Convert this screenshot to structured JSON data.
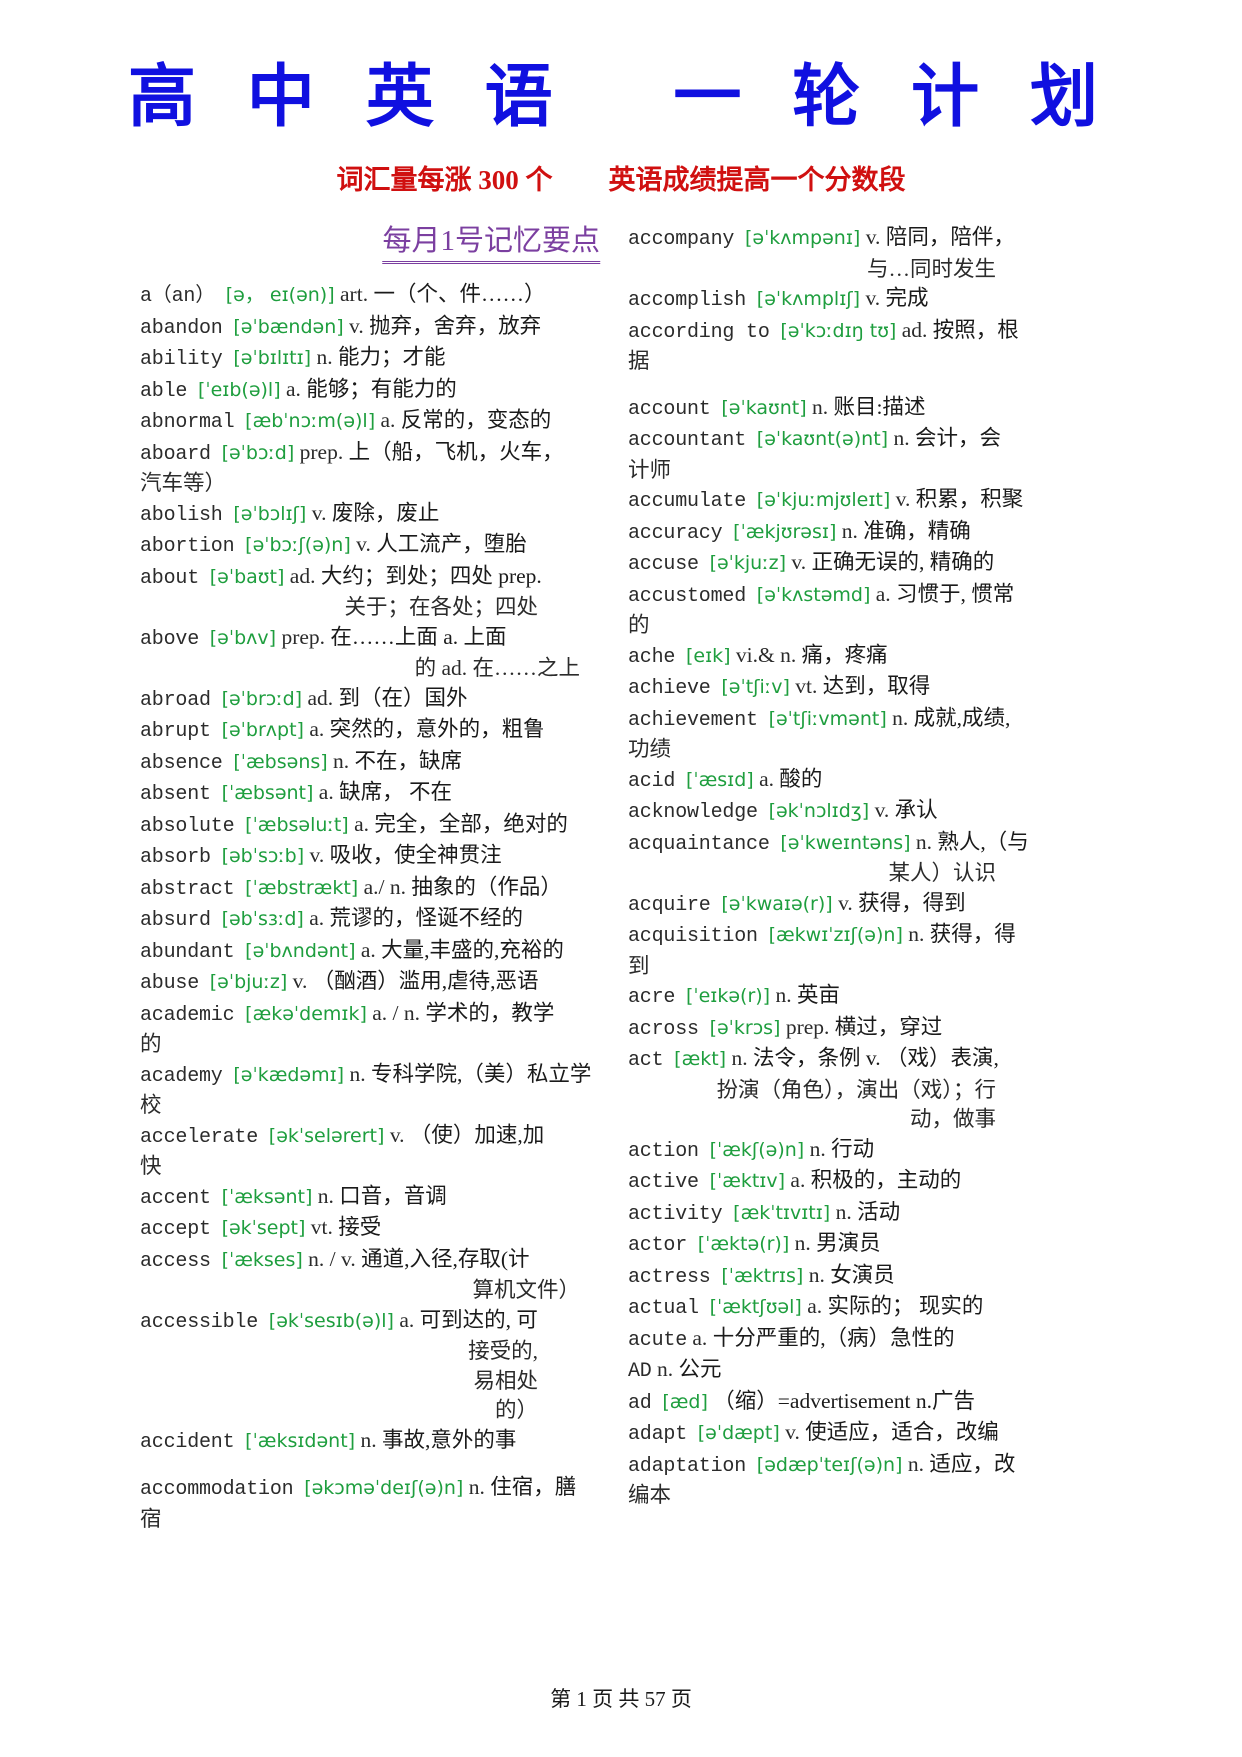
{
  "header": {
    "title": "高 中 英 语   一 轮 计 划",
    "subtitle_left": "词汇量每涨 300 个",
    "subtitle_right": "英语成绩提高一个分数段",
    "title_color": "#1010e0",
    "subtitle_color": "#d01010"
  },
  "section": {
    "heading": "每月1号记忆要点",
    "heading_color": "#7b3fa0"
  },
  "styles": {
    "phonetic_color": "#1e9e3e",
    "text_color": "#2b2b2b"
  },
  "left_column": [
    {
      "word": "a（an）",
      "phonetic": "[ə， eɪ(ən)]",
      "pos": "art.",
      "cn": "一（个、件……）"
    },
    {
      "word": "abandon",
      "phonetic": "[əˈbændən]",
      "pos": "v.",
      "cn": "抛弃，舍弃，放弃"
    },
    {
      "word": "ability",
      "phonetic": "[əˈbɪlɪtɪ]",
      "pos": "n.",
      "cn": "能力；才能"
    },
    {
      "word": "able",
      "phonetic": "[ˈeɪb(ə)l]",
      "pos": "a.",
      "cn": "能够；有能力的"
    },
    {
      "word": "abnormal",
      "phonetic": "[æbˈnɔːm(ə)l]",
      "pos": "a.",
      "cn": "反常的，变态的"
    },
    {
      "word": "aboard",
      "phonetic": "[əˈbɔːd]",
      "pos": "prep.",
      "cn": "上（船，飞机，火车，",
      "cont": [
        "汽车等）"
      ],
      "cont_align": "left"
    },
    {
      "word": "abolish",
      "phonetic": "[əˈbɔlɪʃ]",
      "pos": "v.",
      "cn": "废除，废止"
    },
    {
      "word": "abortion",
      "phonetic": "[əˈbɔːʃ(ə)n]",
      "pos": "v.",
      "cn": "人工流产，堕胎"
    },
    {
      "word": "about",
      "phonetic": "[əˈbaʊt]",
      "pos": "ad.",
      "cn": "大约；到处；四处 prep.",
      "cont": [
        "关于；在各处；四处"
      ],
      "cont_align": "wide"
    },
    {
      "word": "above",
      "phonetic": "[əˈbʌv]",
      "pos": "prep.",
      "cn": "在……上面 a. 上面",
      "cont": [
        "的 ad. 在……之上"
      ],
      "cont_align": "mid"
    },
    {
      "word": "abroad",
      "phonetic": "[əˈbrɔːd]",
      "pos": "ad.",
      "cn": "到（在）国外"
    },
    {
      "word": "abrupt",
      "phonetic": "[əˈbrʌpt]",
      "pos": "a.",
      "cn": "突然的，意外的，粗鲁"
    },
    {
      "word": "absence",
      "phonetic": "[ˈæbsəns]",
      "pos": "n.",
      "cn": "不在，缺席"
    },
    {
      "word": "absent",
      "phonetic": "[ˈæbsənt]",
      "pos": "a.",
      "cn": "缺席， 不在"
    },
    {
      "word": "absolute",
      "phonetic": "[ˈæbsəluːt]",
      "pos": "a.",
      "cn": "完全，全部，绝对的"
    },
    {
      "word": "absorb",
      "phonetic": "[əbˈsɔːb]",
      "pos": "v.",
      "cn": "吸收，使全神贯注"
    },
    {
      "word": "abstract",
      "phonetic": "[ˈæbstrækt]",
      "pos": "a./ n.",
      "cn": "抽象的（作品）"
    },
    {
      "word": "absurd",
      "phonetic": "[əbˈsɜːd]",
      "pos": "a.",
      "cn": "荒谬的，怪诞不经的"
    },
    {
      "word": "abundant",
      "phonetic": "[əˈbʌndənt]",
      "pos": "a.",
      "cn": "大量,丰盛的,充裕的"
    },
    {
      "word": "abuse",
      "phonetic": "[əˈbjuːz]",
      "pos": "v.",
      "cn": "（酗酒）滥用,虐待,恶语"
    },
    {
      "word": "academic",
      "phonetic": "[ækəˈdemɪk]",
      "pos": "a. / n.",
      "cn": "学术的，教学",
      "cont": [
        "的"
      ],
      "cont_align": "left"
    },
    {
      "word": "academy",
      "phonetic": "[əˈkædəmɪ]",
      "pos": "n.",
      "cn": "专科学院,（美）私立学",
      "cont": [
        "校"
      ],
      "cont_align": "left"
    },
    {
      "word": "accelerate",
      "phonetic": "[əkˈselərert]",
      "pos": "v.",
      "cn": "（使）加速,加",
      "cont": [
        "快"
      ],
      "cont_align": "left"
    },
    {
      "word": "accent",
      "phonetic": "[ˈæksənt]",
      "pos": "n.",
      "cn": "口音，音调"
    },
    {
      "word": "accept",
      "phonetic": "[əkˈsept]",
      "pos": "vt.",
      "cn": "接受"
    },
    {
      "word": "access",
      "phonetic": "[ˈækses]",
      "pos": "n. / v.",
      "cn": "通道,入径,存取(计",
      "cont": [
        "算机文件）"
      ],
      "cont_align": "mid"
    },
    {
      "word": "accessible",
      "phonetic": "[əkˈsesɪb(ə)l]",
      "pos": "a.",
      "cn": "可到达的, 可",
      "cont": [
        "接受的,",
        "易相处",
        "的）"
      ],
      "cont_align": "wide"
    },
    {
      "word": "accident",
      "phonetic": "[ˈæksɪdənt]",
      "pos": "n.",
      "cn": "事故,意外的事",
      "gap_after": true
    },
    {
      "word": "accommodation",
      "phonetic": "[əkɔməˈdeɪʃ(ə)n]",
      "pos": "n.",
      "cn": "住宿，膳",
      "cont": [
        "宿"
      ],
      "cont_align": "left"
    }
  ],
  "right_column": [
    {
      "word": "accompany",
      "phonetic": "[əˈkʌmpənɪ]",
      "pos": "v.",
      "cn": "陪同，陪伴，",
      "cont": [
        "与…同时发生"
      ],
      "cont_align": "wide"
    },
    {
      "word": "accomplish",
      "phonetic": "[əˈkʌmplɪʃ]",
      "pos": "v.",
      "cn": "完成"
    },
    {
      "word": "according to",
      "phonetic": "[əˈkɔːdɪŋ tʊ]",
      "pos": "ad.",
      "cn": "按照，根",
      "cont": [
        "据"
      ],
      "cont_align": "left",
      "gap_after": true
    },
    {
      "word": "account",
      "phonetic": "[əˈkaʊnt]",
      "pos": "n.",
      "cn": "账目:描述"
    },
    {
      "word": "accountant",
      "phonetic": "[əˈkaʊnt(ə)nt]",
      "pos": "n.",
      "cn": "会计，会",
      "cont": [
        "计师"
      ],
      "cont_align": "left"
    },
    {
      "word": "accumulate",
      "phonetic": "[əˈkjuːmjʊleɪt]",
      "pos": "v.",
      "cn": "积累，积聚"
    },
    {
      "word": "accuracy",
      "phonetic": "[ˈækjʊrəsɪ]",
      "pos": "n.",
      "cn": "准确，精确"
    },
    {
      "word": "accuse",
      "phonetic": "[əˈkjuːz]",
      "pos": "v.",
      "cn": "正确无误的, 精确的"
    },
    {
      "word": "accustomed",
      "phonetic": "[əˈkʌstəmd]",
      "pos": "a.",
      "cn": "习惯于, 惯常",
      "cont": [
        "的"
      ],
      "cont_align": "left"
    },
    {
      "word": "ache",
      "phonetic": "[eɪk]",
      "pos": "vi.& n.",
      "cn": "痛，疼痛"
    },
    {
      "word": "achieve",
      "phonetic": "[əˈtʃiːv]",
      "pos": "vt.",
      "cn": "达到，取得"
    },
    {
      "word": "achievement",
      "phonetic": "[əˈtʃiːvmənt]",
      "pos": "n.",
      "cn": "成就,成绩,",
      "cont": [
        "功绩"
      ],
      "cont_align": "left"
    },
    {
      "word": "acid",
      "phonetic": "[ˈæsɪd]",
      "pos": "a.",
      "cn": "酸的"
    },
    {
      "word": "acknowledge",
      "phonetic": "[əkˈnɔlɪdʒ]",
      "pos": "v.",
      "cn": "承认"
    },
    {
      "word": "acquaintance",
      "phonetic": "[əˈkweɪntəns]",
      "pos": "n.",
      "cn": "熟人,（与",
      "cont": [
        "某人）认识"
      ],
      "cont_align": "wide"
    },
    {
      "word": "acquire",
      "phonetic": "[əˈkwaɪə(r)]",
      "pos": "v.",
      "cn": "获得，得到"
    },
    {
      "word": "acquisition",
      "phonetic": "[ækwɪˈzɪʃ(ə)n]",
      "pos": "n.",
      "cn": "获得，得",
      "cont": [
        "到"
      ],
      "cont_align": "left"
    },
    {
      "word": "acre",
      "phonetic": "[ˈeɪkə(r)]",
      "pos": "n.",
      "cn": "英亩"
    },
    {
      "word": "across",
      "phonetic": "[əˈkrɔs]",
      "pos": "prep.",
      "cn": "横过，穿过"
    },
    {
      "word": "act",
      "phonetic": "[ækt]",
      "pos": "n.",
      "cn": "法令，条例 v. （戏）表演,",
      "cont": [
        "扮演（角色），演出（戏）；行",
        "动，做事"
      ],
      "cont_align": "wide"
    },
    {
      "word": "action",
      "phonetic": "[ˈækʃ(ə)n]",
      "pos": "n.",
      "cn": "行动"
    },
    {
      "word": "active",
      "phonetic": "[ˈæktɪv]",
      "pos": "a.",
      "cn": "积极的，主动的"
    },
    {
      "word": "activity",
      "phonetic": "[ækˈtɪvɪtɪ]",
      "pos": "n.",
      "cn": "活动"
    },
    {
      "word": "actor",
      "phonetic": "[ˈæktə(r)]",
      "pos": "n.",
      "cn": "男演员"
    },
    {
      "word": "actress",
      "phonetic": "[ˈæktrɪs]",
      "pos": "n.",
      "cn": "女演员"
    },
    {
      "word": "actual",
      "phonetic": "[ˈæktʃʊəl]",
      "pos": "a.",
      "cn": "实际的； 现实的"
    },
    {
      "word": "acute",
      "phonetic": "",
      "pos": "a.",
      "cn": "十分严重的,（病）急性的"
    },
    {
      "word": "AD",
      "phonetic": "",
      "pos": "n.",
      "cn": "公元"
    },
    {
      "word": "ad",
      "phonetic": "[æd]",
      "pos": "",
      "cn": "（缩）=advertisement n.广告"
    },
    {
      "word": "adapt",
      "phonetic": "[əˈdæpt]",
      "pos": "v.",
      "cn": "使适应，适合，改编"
    },
    {
      "word": "adaptation",
      "phonetic": "[ədæpˈteɪʃ(ə)n]",
      "pos": "n.",
      "cn": "适应，改",
      "cont": [
        "编本"
      ],
      "cont_align": "left"
    }
  ],
  "footer": {
    "text": "第 1 页 共 57 页"
  }
}
